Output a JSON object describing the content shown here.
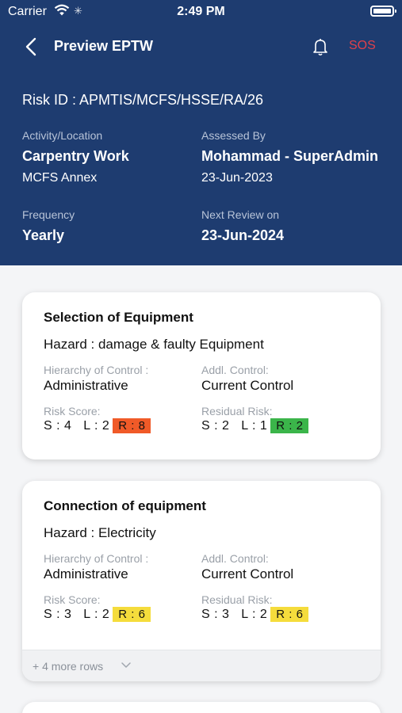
{
  "status": {
    "carrier": "Carrier",
    "time": "2:49 PM"
  },
  "nav": {
    "title": "Preview EPTW",
    "sos": "SOS"
  },
  "info": {
    "risk_id": "Risk ID : APMTIS/MCFS/HSSE/RA/26",
    "activity_label": "Activity/Location",
    "activity_value": "Carpentry Work",
    "activity_sub": "MCFS Annex",
    "assessed_label": "Assessed By",
    "assessed_value": "Mohammad - SuperAdmin",
    "assessed_date": "23-Jun-2023",
    "frequency_label": "Frequency",
    "frequency_value": "Yearly",
    "next_review_label": "Next Review on",
    "next_review_value": "23-Jun-2024"
  },
  "colors": {
    "header_bg": "#1e3c70",
    "sos": "#e0404a",
    "risk_high": "#f05a28",
    "risk_low": "#3bb54a",
    "risk_medium": "#f5dc3c"
  },
  "cards": [
    {
      "title": "Selection of Equipment",
      "hazard": "Hazard : damage & faulty Equipment",
      "hoc_label": "Hierarchy of Control :",
      "hoc_value": "Administrative",
      "addl_label": "Addl. Control:",
      "addl_value": "Current Control",
      "risk_label": "Risk Score:",
      "risk_scores": "S : 4   L : 2",
      "risk_badge": "R : 8",
      "residual_label": "Residual Risk:",
      "residual_scores": "S : 2   L : 1",
      "residual_badge": "R : 2"
    },
    {
      "title": "Connection of equipment",
      "hazard": "Hazard : Electricity",
      "hoc_label": "Hierarchy of Control :",
      "hoc_value": "Administrative",
      "addl_label": "Addl. Control:",
      "addl_value": "Current Control",
      "risk_label": "Risk Score:",
      "risk_scores": "S : 3   L : 2",
      "risk_badge": "R : 6",
      "residual_label": "Residual Risk:",
      "residual_scores": "S : 3   L : 2",
      "residual_badge": "R : 6",
      "more_rows": "+ 4  more rows"
    }
  ]
}
